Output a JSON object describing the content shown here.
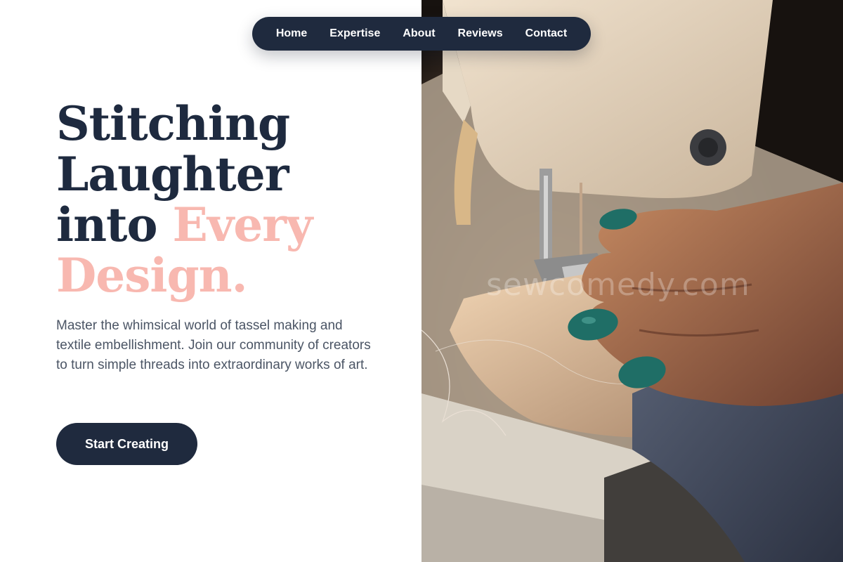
{
  "nav": {
    "items": [
      {
        "label": "Home"
      },
      {
        "label": "Expertise"
      },
      {
        "label": "About"
      },
      {
        "label": "Reviews"
      },
      {
        "label": "Contact"
      }
    ]
  },
  "hero": {
    "headline_line1": "Stitching",
    "headline_line2": "Laughter",
    "headline_line3_start": "into ",
    "headline_line3_accent": "Every",
    "headline_line4_accent": "Design.",
    "subtitle": "Master the whimsical world of tassel making and textile embellishment. Join our community of creators to turn simple threads into extraordinary works of art.",
    "cta_label": "Start Creating",
    "image_watermark": "sewcomedy.com"
  },
  "colors": {
    "navy": "#1f2a3e",
    "accent_pink": "#f8b8b0",
    "body_text": "#4b5565"
  }
}
